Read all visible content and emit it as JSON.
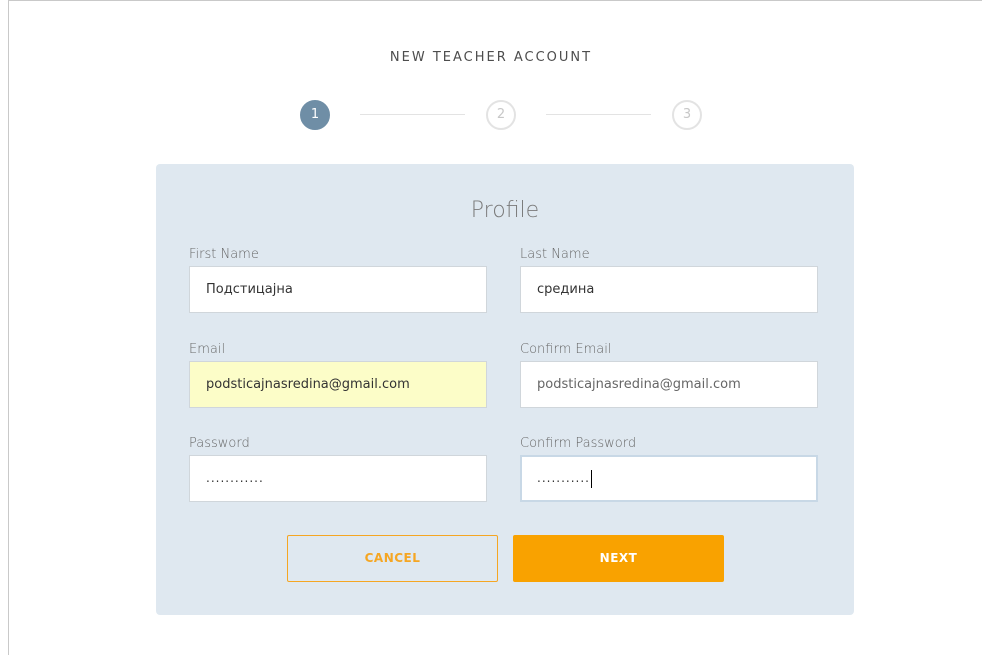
{
  "header": {
    "title": "NEW TEACHER ACCOUNT"
  },
  "stepper": {
    "steps": [
      {
        "label": "1",
        "state": "active"
      },
      {
        "label": "2",
        "state": "inactive"
      },
      {
        "label": "3",
        "state": "inactive"
      }
    ]
  },
  "form": {
    "title": "Profile",
    "first_name": {
      "label": "First Name",
      "value": "Подстицајна"
    },
    "last_name": {
      "label": "Last Name",
      "value": "средина"
    },
    "email": {
      "label": "Email",
      "value": "podsticajnasredina@gmail.com"
    },
    "confirm_email": {
      "label": "Confirm Email",
      "value": "podsticajnasredina@gmail.com"
    },
    "password": {
      "label": "Password",
      "value": "............"
    },
    "confirm_password": {
      "label": "Confirm Password",
      "value": "..........."
    }
  },
  "buttons": {
    "cancel_label": "CANCEL",
    "next_label": "NEXT"
  },
  "colors": {
    "accent": "#f9a200",
    "step_active": "#6f8ea6",
    "panel_bg": "#dfe8f0",
    "autofill": "#fcfdc8"
  }
}
